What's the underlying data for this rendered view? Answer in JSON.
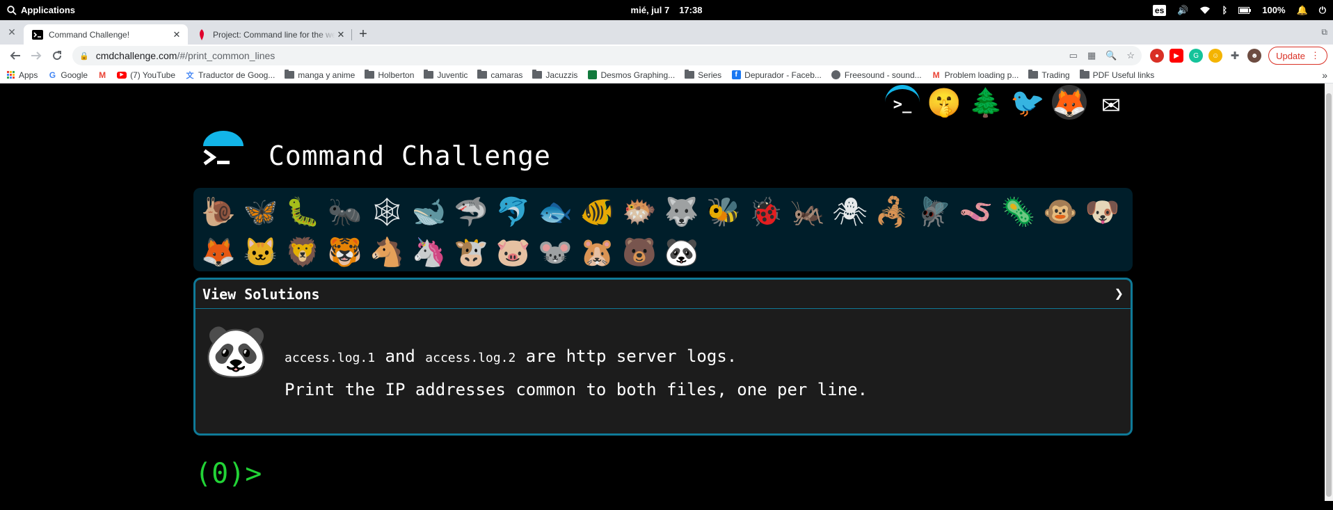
{
  "topbar": {
    "apps_label": "Applications",
    "date": "mié, jul 7",
    "time": "17:38",
    "lang": "es",
    "battery": "100%"
  },
  "tabs": [
    {
      "title": "Command Challenge!",
      "active": true
    },
    {
      "title": "Project: Command line for the web",
      "active": false
    }
  ],
  "address": {
    "host": "cmdchallenge.com",
    "path": "/#/print_common_lines"
  },
  "update_label": "Update",
  "bookmarks": [
    {
      "label": "Apps",
      "icon": "apps-grid"
    },
    {
      "label": "Google",
      "icon": "google"
    },
    {
      "label": "",
      "icon": "gmail"
    },
    {
      "label": "(7) YouTube",
      "icon": "youtube"
    },
    {
      "label": "Traductor de Goog...",
      "icon": "translate"
    },
    {
      "label": "manga y anime",
      "icon": "folder"
    },
    {
      "label": "Holberton",
      "icon": "folder"
    },
    {
      "label": "Juventic",
      "icon": "folder"
    },
    {
      "label": "camaras",
      "icon": "folder"
    },
    {
      "label": "Jacuzzis",
      "icon": "folder"
    },
    {
      "label": "Desmos Graphing...",
      "icon": "desmos"
    },
    {
      "label": "Series",
      "icon": "folder"
    },
    {
      "label": "Depurador - Faceb...",
      "icon": "facebook"
    },
    {
      "label": "Freesound - sound...",
      "icon": "freesound"
    },
    {
      "label": "Problem loading p...",
      "icon": "gmail"
    },
    {
      "label": "Trading",
      "icon": "folder"
    },
    {
      "label": "PDF Useful links",
      "icon": "folder"
    }
  ],
  "social_icons": [
    {
      "name": "cmdchallenge-icon",
      "glyph": ">_"
    },
    {
      "name": "shush-emoji-icon",
      "glyph": "🤫"
    },
    {
      "name": "tree-icon",
      "glyph": "🌲"
    },
    {
      "name": "twitter-icon",
      "glyph": "🐦"
    },
    {
      "name": "gitlab-icon",
      "glyph": "🦊"
    },
    {
      "name": "mail-icon",
      "glyph": "✉"
    }
  ],
  "site": {
    "title": "Command Challenge"
  },
  "animals": [
    {
      "name": "snail",
      "glyph": "🐌",
      "state": "done"
    },
    {
      "name": "butterfly",
      "glyph": "🦋",
      "state": "done"
    },
    {
      "name": "caterpillar",
      "glyph": "🐛",
      "state": "done"
    },
    {
      "name": "ant",
      "glyph": "🐜",
      "state": "done"
    },
    {
      "name": "spider-web",
      "glyph": "🕸",
      "state": "done"
    },
    {
      "name": "whale",
      "glyph": "🐋",
      "state": "done"
    },
    {
      "name": "shark",
      "glyph": "🦈",
      "state": "done"
    },
    {
      "name": "dolphin",
      "glyph": "🐬",
      "state": "done"
    },
    {
      "name": "fish",
      "glyph": "🐟",
      "state": "done"
    },
    {
      "name": "tropical-fish",
      "glyph": "🐠",
      "state": "done"
    },
    {
      "name": "blowfish",
      "glyph": "🐡",
      "state": "done"
    },
    {
      "name": "wolf",
      "glyph": "🐺",
      "state": "done"
    },
    {
      "name": "bee",
      "glyph": "🐝",
      "state": "done"
    },
    {
      "name": "ladybug",
      "glyph": "🐞",
      "state": "done"
    },
    {
      "name": "cricket",
      "glyph": "🦗",
      "state": "done"
    },
    {
      "name": "spider",
      "glyph": "🕷",
      "state": "done"
    },
    {
      "name": "scorpion",
      "glyph": "🦂",
      "state": "done"
    },
    {
      "name": "fly",
      "glyph": "🪰",
      "state": "done"
    },
    {
      "name": "worm",
      "glyph": "🪱",
      "state": "done"
    },
    {
      "name": "microbe",
      "glyph": "🦠",
      "state": "done"
    },
    {
      "name": "monkey",
      "glyph": "🐵",
      "state": "done"
    },
    {
      "name": "dog",
      "glyph": "🐶",
      "state": "done"
    },
    {
      "name": "fox",
      "glyph": "🦊",
      "state": "done"
    },
    {
      "name": "cat",
      "glyph": "🐱",
      "state": "done"
    },
    {
      "name": "lion",
      "glyph": "🦁",
      "state": "done"
    },
    {
      "name": "tiger",
      "glyph": "🐯",
      "state": "done"
    },
    {
      "name": "horse",
      "glyph": "🐴",
      "state": "done"
    },
    {
      "name": "unicorn",
      "glyph": "🦄",
      "state": "done"
    },
    {
      "name": "cow",
      "glyph": "🐮",
      "state": "done"
    },
    {
      "name": "pig",
      "glyph": "🐷",
      "state": "done"
    },
    {
      "name": "mouse",
      "glyph": "🐭",
      "state": "done"
    },
    {
      "name": "hamster",
      "glyph": "🐹",
      "state": "done"
    },
    {
      "name": "bear",
      "glyph": "🐻",
      "state": "done"
    },
    {
      "name": "panda",
      "glyph": "🐼",
      "state": "current"
    }
  ],
  "challenge": {
    "header": "View Solutions",
    "chevron": "❯",
    "avatar_glyph": "🐼",
    "file1": "access.log.1",
    "and_word": " and ",
    "file2": "access.log.2",
    "line1_rest": " are http server logs.",
    "line2": "Print the IP addresses common to both files, one per line."
  },
  "prompt": "(0)>",
  "colors": {
    "accent": "#0f7a98",
    "prompt": "#22d336",
    "panel_bg": "#001e2a"
  }
}
